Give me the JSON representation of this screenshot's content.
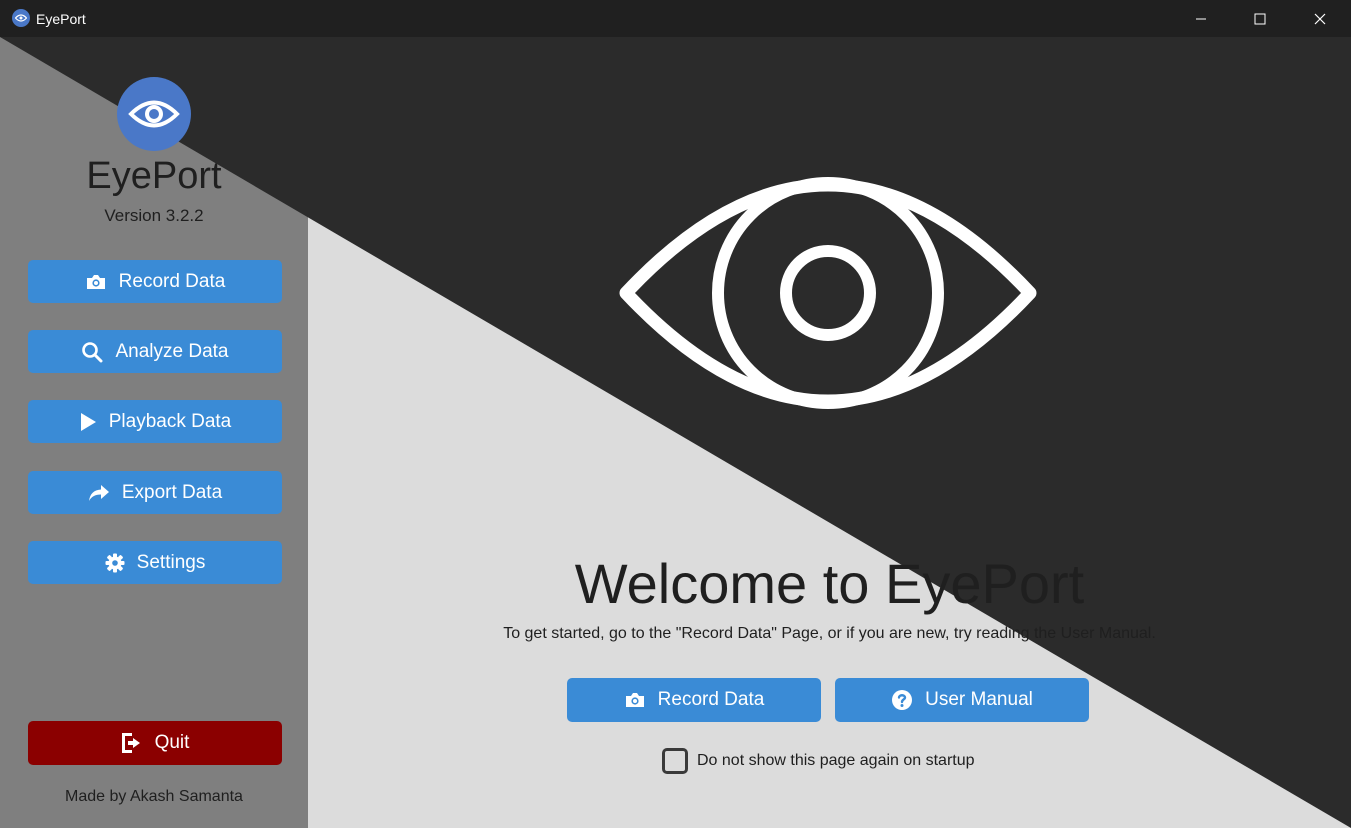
{
  "window": {
    "title": "EyePort",
    "controls": [
      "minimize-icon",
      "maximize-icon",
      "close-icon"
    ]
  },
  "colors": {
    "accent": "#3a8bd6",
    "quit": "#8b0000",
    "logo": "#4a78c8",
    "dark_bg": "#2b2b2b",
    "light_bg": "#dcdcdc",
    "sidebar_light": "#7f7f7f"
  },
  "sidebar": {
    "app_name": "EyePort",
    "version": "Version 3.2.2",
    "buttons": [
      {
        "label": "Record Data",
        "icon": "camera-icon"
      },
      {
        "label": "Analyze Data",
        "icon": "search-icon"
      },
      {
        "label": "Playback Data",
        "icon": "play-icon"
      },
      {
        "label": "Export Data",
        "icon": "share-arrow-icon"
      },
      {
        "label": "Settings",
        "icon": "gear-icon"
      }
    ],
    "quit_label": "Quit",
    "credit": "Made by Akash Samanta"
  },
  "main": {
    "welcome": "Welcome to EyePort",
    "subtitle": "To get started, go to the \"Record Data\" Page, or if you are new, try reading the User Manual.",
    "record_button": "Record Data",
    "manual_button": "User Manual",
    "checkbox_label": "Do not show this page again on startup",
    "checkbox_checked": false
  }
}
